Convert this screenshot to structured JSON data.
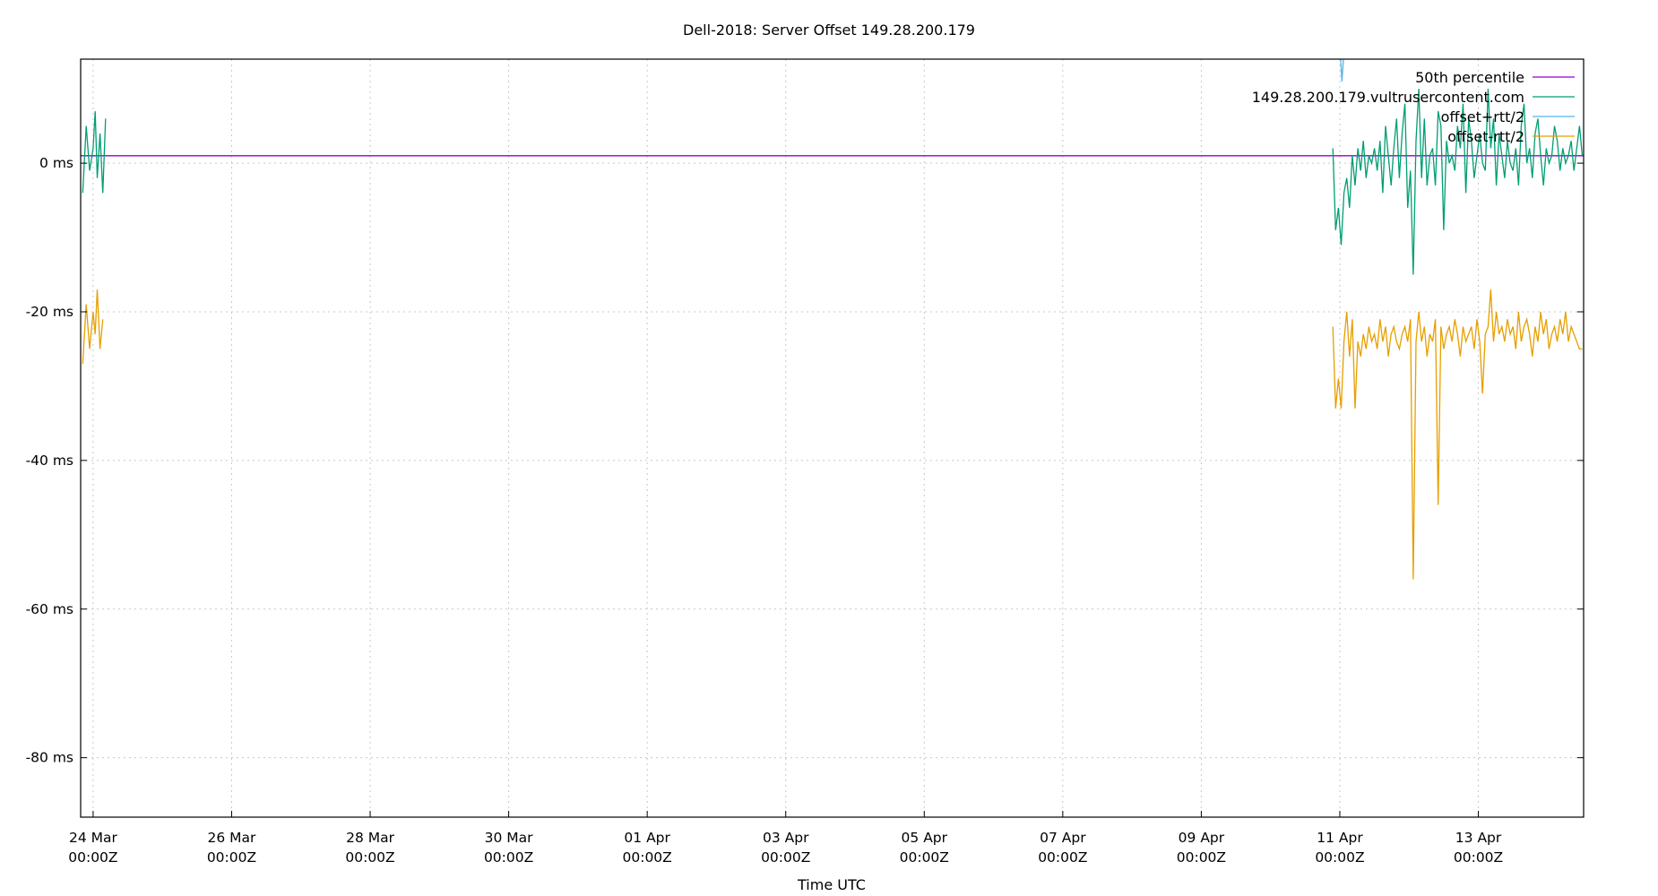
{
  "chart_data": {
    "type": "line",
    "title": "Dell-2018: Server Offset 149.28.200.179",
    "xlabel": "Time UTC",
    "ylabel": "",
    "x_unit": "days since 24 Mar 00:00Z",
    "xlim": [
      -0.18,
      21.52
    ],
    "ylim": [
      -88,
      14
    ],
    "grid": true,
    "legend_position": "top-right",
    "x_ticks": [
      {
        "value": 0,
        "line1": "24 Mar",
        "line2": "00:00Z"
      },
      {
        "value": 2,
        "line1": "26 Mar",
        "line2": "00:00Z"
      },
      {
        "value": 4,
        "line1": "28 Mar",
        "line2": "00:00Z"
      },
      {
        "value": 6,
        "line1": "30 Mar",
        "line2": "00:00Z"
      },
      {
        "value": 8,
        "line1": "01 Apr",
        "line2": "00:00Z"
      },
      {
        "value": 10,
        "line1": "03 Apr",
        "line2": "00:00Z"
      },
      {
        "value": 12,
        "line1": "05 Apr",
        "line2": "00:00Z"
      },
      {
        "value": 14,
        "line1": "07 Apr",
        "line2": "00:00Z"
      },
      {
        "value": 16,
        "line1": "09 Apr",
        "line2": "00:00Z"
      },
      {
        "value": 18,
        "line1": "11 Apr",
        "line2": "00:00Z"
      },
      {
        "value": 20,
        "line1": "13 Apr",
        "line2": "00:00Z"
      }
    ],
    "y_ticks": [
      {
        "value": 0,
        "label": "0 ms"
      },
      {
        "value": -20,
        "label": "-20 ms"
      },
      {
        "value": -40,
        "label": "-40 ms"
      },
      {
        "value": -60,
        "label": "-60 ms"
      },
      {
        "value": -80,
        "label": "-80 ms"
      }
    ],
    "series": [
      {
        "name": "50th percentile",
        "color": "#9400d3",
        "x": [
          -0.18,
          21.52
        ],
        "y": [
          1.0,
          1.0
        ]
      },
      {
        "name": "149.28.200.179.vultrusercontent.com",
        "color": "#009e73",
        "segments": [
          {
            "x": [
              -0.15,
              -0.1,
              -0.05,
              0.0,
              0.03,
              0.06,
              0.1,
              0.14,
              0.18
            ],
            "y": [
              -4,
              5,
              -1,
              2,
              7,
              -2,
              4,
              -4,
              6
            ]
          },
          {
            "x": [
              17.9,
              17.94,
              17.98,
              18.02,
              18.06,
              18.1,
              18.14,
              18.18,
              18.22,
              18.26,
              18.3,
              18.34,
              18.38,
              18.42,
              18.46,
              18.5,
              18.54,
              18.58,
              18.62,
              18.66,
              18.7,
              18.74,
              18.78,
              18.82,
              18.86,
              18.9,
              18.94,
              18.98,
              19.02,
              19.06,
              19.1,
              19.14,
              19.18,
              19.22,
              19.26,
              19.3,
              19.34,
              19.38,
              19.42,
              19.46,
              19.5,
              19.54,
              19.58,
              19.62,
              19.66,
              19.7,
              19.74,
              19.78,
              19.82,
              19.86,
              19.9,
              19.94,
              19.98,
              20.02,
              20.06,
              20.1,
              20.14,
              20.18,
              20.22,
              20.26,
              20.3,
              20.34,
              20.38,
              20.42,
              20.46,
              20.5,
              20.54,
              20.58,
              20.62,
              20.66,
              20.7,
              20.74,
              20.78,
              20.82,
              20.86,
              20.9,
              20.94,
              20.98,
              21.02,
              21.06,
              21.1,
              21.14,
              21.18,
              21.22,
              21.26,
              21.3,
              21.34,
              21.38,
              21.42,
              21.46,
              21.5
            ],
            "y": [
              2,
              -9,
              -6,
              -11,
              -4,
              -2,
              -6,
              1,
              -3,
              2,
              -1,
              3,
              -2,
              1,
              0,
              2,
              -1,
              3,
              -4,
              5,
              1,
              -3,
              2,
              6,
              -2,
              4,
              8,
              -6,
              -1,
              -15,
              3,
              10,
              -2,
              6,
              -3,
              1,
              2,
              -3,
              7,
              5,
              -9,
              3,
              0,
              1,
              -1,
              5,
              2,
              8,
              -4,
              6,
              3,
              -2,
              1,
              4,
              0,
              -1,
              10,
              2,
              6,
              -3,
              4,
              1,
              -2,
              3,
              0,
              -1,
              2,
              -3,
              5,
              8,
              0,
              2,
              -2,
              4,
              6,
              1,
              -3,
              2,
              0,
              1,
              5,
              3,
              -1,
              2,
              0,
              1,
              3,
              -1,
              2,
              5,
              1
            ]
          }
        ]
      },
      {
        "name": "offset+rtt/2",
        "color": "#56b4e9",
        "segments": [
          {
            "x": [
              18.0,
              18.03,
              18.06
            ],
            "y": [
              16,
              11,
              15
            ]
          }
        ]
      },
      {
        "name": "offset-rtt/2",
        "color": "#e69f00",
        "segments": [
          {
            "x": [
              -0.15,
              -0.1,
              -0.05,
              0.0,
              0.03,
              0.06,
              0.1,
              0.14
            ],
            "y": [
              -27,
              -19,
              -25,
              -20,
              -23,
              -17,
              -25,
              -21
            ]
          },
          {
            "x": [
              17.9,
              17.94,
              17.98,
              18.02,
              18.06,
              18.1,
              18.14,
              18.18,
              18.22,
              18.26,
              18.3,
              18.34,
              18.38,
              18.42,
              18.46,
              18.5,
              18.54,
              18.58,
              18.62,
              18.66,
              18.7,
              18.74,
              18.78,
              18.82,
              18.86,
              18.9,
              18.94,
              18.98,
              19.02,
              19.06,
              19.1,
              19.14,
              19.18,
              19.22,
              19.26,
              19.3,
              19.34,
              19.38,
              19.42,
              19.46,
              19.5,
              19.54,
              19.58,
              19.62,
              19.66,
              19.7,
              19.74,
              19.78,
              19.82,
              19.86,
              19.9,
              19.94,
              19.98,
              20.02,
              20.06,
              20.1,
              20.14,
              20.18,
              20.22,
              20.26,
              20.3,
              20.34,
              20.38,
              20.42,
              20.46,
              20.5,
              20.54,
              20.58,
              20.62,
              20.66,
              20.7,
              20.74,
              20.78,
              20.82,
              20.86,
              20.9,
              20.94,
              20.98,
              21.02,
              21.06,
              21.1,
              21.14,
              21.18,
              21.22,
              21.26,
              21.3,
              21.34,
              21.38,
              21.42,
              21.46,
              21.5
            ],
            "y": [
              -22,
              -33,
              -29,
              -33,
              -24,
              -20,
              -26,
              -21,
              -33,
              -24,
              -26,
              -23,
              -25,
              -22,
              -24,
              -23,
              -25,
              -21,
              -24,
              -22,
              -26,
              -23,
              -22,
              -24,
              -25,
              -23,
              -22,
              -24,
              -21,
              -56,
              -24,
              -20,
              -24,
              -22,
              -26,
              -23,
              -24,
              -21,
              -46,
              -22,
              -25,
              -23,
              -22,
              -24,
              -21,
              -23,
              -26,
              -22,
              -24,
              -23,
              -22,
              -25,
              -21,
              -24,
              -31,
              -23,
              -22,
              -17,
              -24,
              -20,
              -23,
              -22,
              -24,
              -21,
              -23,
              -22,
              -25,
              -20,
              -24,
              -22,
              -21,
              -23,
              -26,
              -22,
              -24,
              -20,
              -23,
              -21,
              -25,
              -23,
              -22,
              -24,
              -21,
              -23,
              -20,
              -24,
              -22,
              -23,
              -24,
              -25,
              -25
            ]
          }
        ]
      }
    ]
  }
}
